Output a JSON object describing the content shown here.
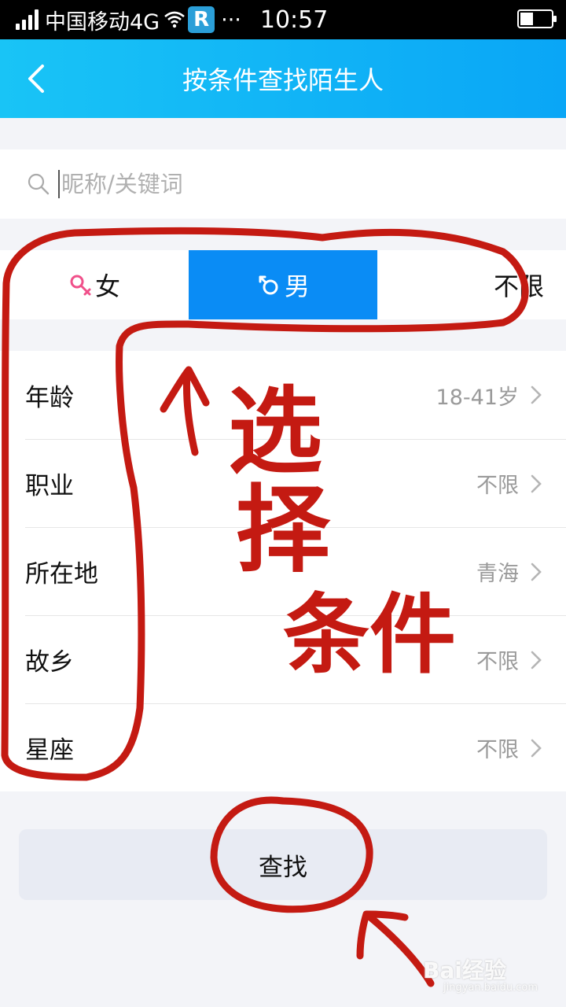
{
  "status_bar": {
    "carrier": "中国移动4G",
    "dots": "···",
    "time": "10:57",
    "r_icon": "R"
  },
  "nav": {
    "title": "按条件查找陌生人"
  },
  "search": {
    "placeholder": "昵称/关键词"
  },
  "gender": {
    "female": "女",
    "male": "男",
    "any": "不限",
    "selected": "male"
  },
  "filters": [
    {
      "label": "年龄",
      "value": "18-41岁"
    },
    {
      "label": "职业",
      "value": "不限"
    },
    {
      "label": "所在地",
      "value": "青海"
    },
    {
      "label": "故乡",
      "value": "不限"
    },
    {
      "label": "星座",
      "value": "不限"
    }
  ],
  "find_button": {
    "label": "查找"
  },
  "annotation": {
    "text": [
      "选",
      "择",
      "条件"
    ],
    "color": "#c41a12"
  },
  "watermark": {
    "text": "Bai经验",
    "sub": "jingyan.baidu.com"
  }
}
